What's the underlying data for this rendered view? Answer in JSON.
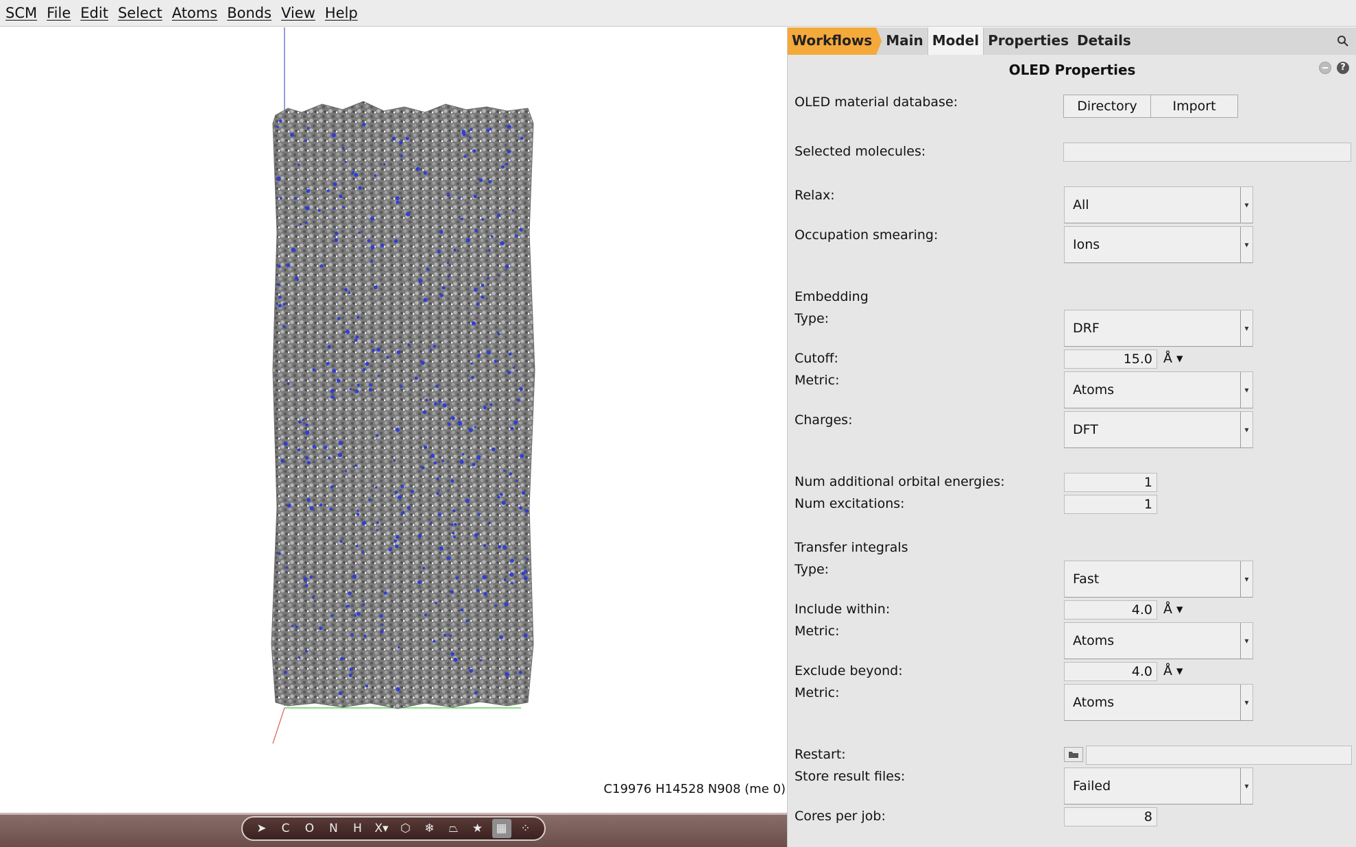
{
  "menubar": {
    "items": [
      "SCM",
      "File",
      "Edit",
      "Select",
      "Atoms",
      "Bonds",
      "View",
      "Help"
    ]
  },
  "viewer": {
    "formula": "C19976 H14528 N908  (me 0)"
  },
  "toolbar": {
    "tools": [
      {
        "icon": "pointer-icon",
        "glyph": "➤"
      },
      {
        "icon": "carbon-icon",
        "glyph": "C"
      },
      {
        "icon": "oxygen-icon",
        "glyph": "O"
      },
      {
        "icon": "nitrogen-icon",
        "glyph": "N"
      },
      {
        "icon": "hydrogen-icon",
        "glyph": "H"
      },
      {
        "icon": "other-element-icon",
        "glyph": "X▾"
      },
      {
        "icon": "ring-icon",
        "glyph": "⬡"
      },
      {
        "icon": "structure-icon",
        "glyph": "❄"
      },
      {
        "icon": "bookmark-icon",
        "glyph": "⏢"
      },
      {
        "icon": "star-icon",
        "glyph": "★"
      },
      {
        "icon": "grid-icon",
        "glyph": "▦"
      },
      {
        "icon": "dots-icon",
        "glyph": "⁘"
      }
    ]
  },
  "panel": {
    "tabs": [
      "Workflows",
      "Main",
      "Model",
      "Properties",
      "Details"
    ],
    "title": "OLED Properties",
    "help_glyph": "?",
    "db_label": "OLED material database:",
    "directory_label": "Directory",
    "import_label": "Import",
    "selected_label": "Selected molecules:",
    "relax_label": "Relax:",
    "relax_value": "All",
    "smearing_label": "Occupation smearing:",
    "smearing_value": "Ions",
    "embedding_header": "Embedding",
    "emb_type_label": "Type:",
    "emb_type_value": "DRF",
    "cutoff_label": "Cutoff:",
    "cutoff_value": "15.0",
    "unit": "Å ▾",
    "emb_metric_label": "Metric:",
    "emb_metric_value": "Atoms",
    "charges_label": "Charges:",
    "charges_value": "DFT",
    "num_orb_label": "Num additional orbital energies:",
    "num_orb_value": "1",
    "num_exc_label": "Num excitations:",
    "num_exc_value": "1",
    "ti_header": "Transfer integrals",
    "ti_type_label": "Type:",
    "ti_type_value": "Fast",
    "include_label": "Include within:",
    "include_value": "4.0",
    "include_metric_label": "Metric:",
    "include_metric_value": "Atoms",
    "exclude_label": "Exclude beyond:",
    "exclude_value": "4.0",
    "exclude_metric_label": "Metric:",
    "exclude_metric_value": "Atoms",
    "restart_label": "Restart:",
    "store_label": "Store result files:",
    "store_value": "Failed",
    "cores_label": "Cores per job:",
    "cores_value": "8",
    "arrow_glyph": "▾"
  }
}
